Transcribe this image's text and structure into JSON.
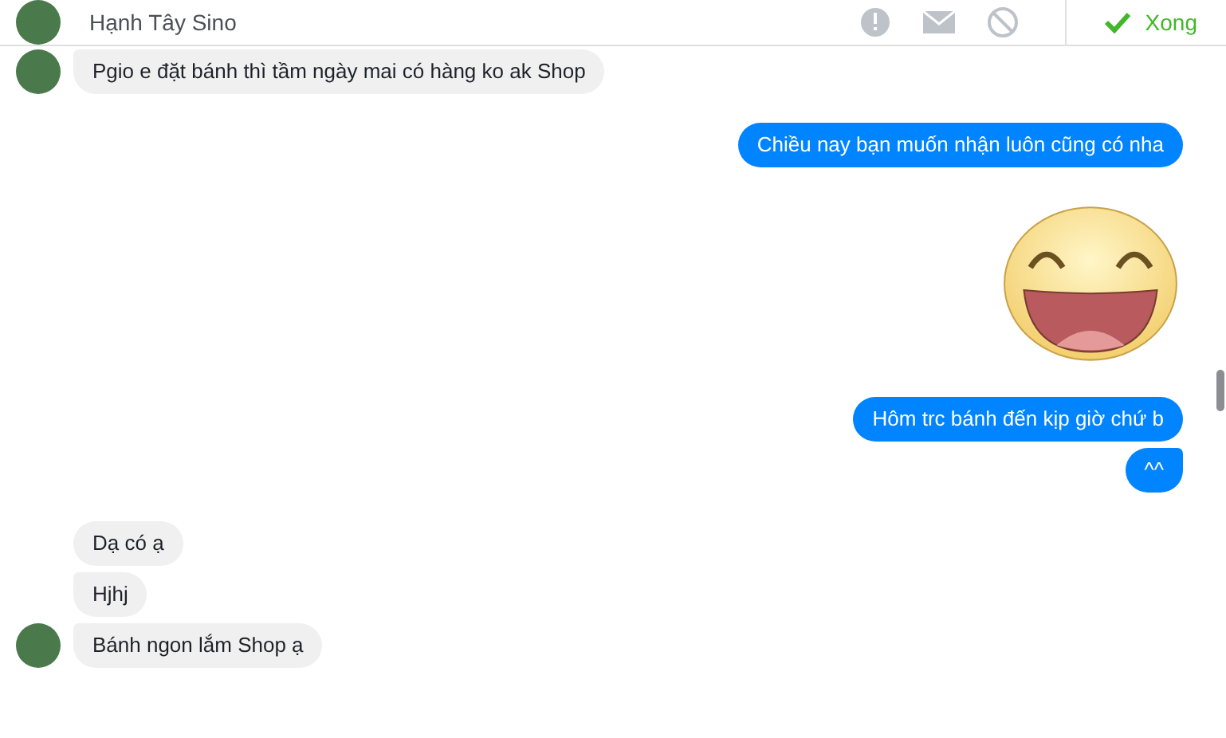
{
  "header": {
    "name": "Hạnh Tây Sino",
    "done_button": "Xong"
  },
  "messages": [
    {
      "outgoing": false,
      "kind": "text",
      "text": "Pgio e đặt bánh thì tầm ngày mai có hàng ko ak Shop",
      "avatar": true,
      "new_group": false
    },
    {
      "outgoing": true,
      "kind": "text",
      "text": "Chiều nay bạn muốn nhận luôn cũng có nha",
      "avatar": false,
      "new_group": true
    },
    {
      "outgoing": true,
      "kind": "sticker",
      "avatar": false,
      "new_group": true
    },
    {
      "outgoing": true,
      "kind": "text",
      "text": "Hôm trc bánh đến kịp giờ chứ b",
      "avatar": false,
      "new_group": true
    },
    {
      "outgoing": true,
      "kind": "text",
      "text": "^^",
      "avatar": false,
      "new_group": false
    },
    {
      "outgoing": false,
      "kind": "text",
      "text": "Dạ có ạ",
      "avatar": false,
      "new_group": true
    },
    {
      "outgoing": false,
      "kind": "text",
      "text": "Hjhj",
      "avatar": false,
      "new_group": false
    },
    {
      "outgoing": false,
      "kind": "text",
      "text": "Bánh ngon lắm Shop ạ",
      "avatar": true,
      "new_group": false
    }
  ]
}
